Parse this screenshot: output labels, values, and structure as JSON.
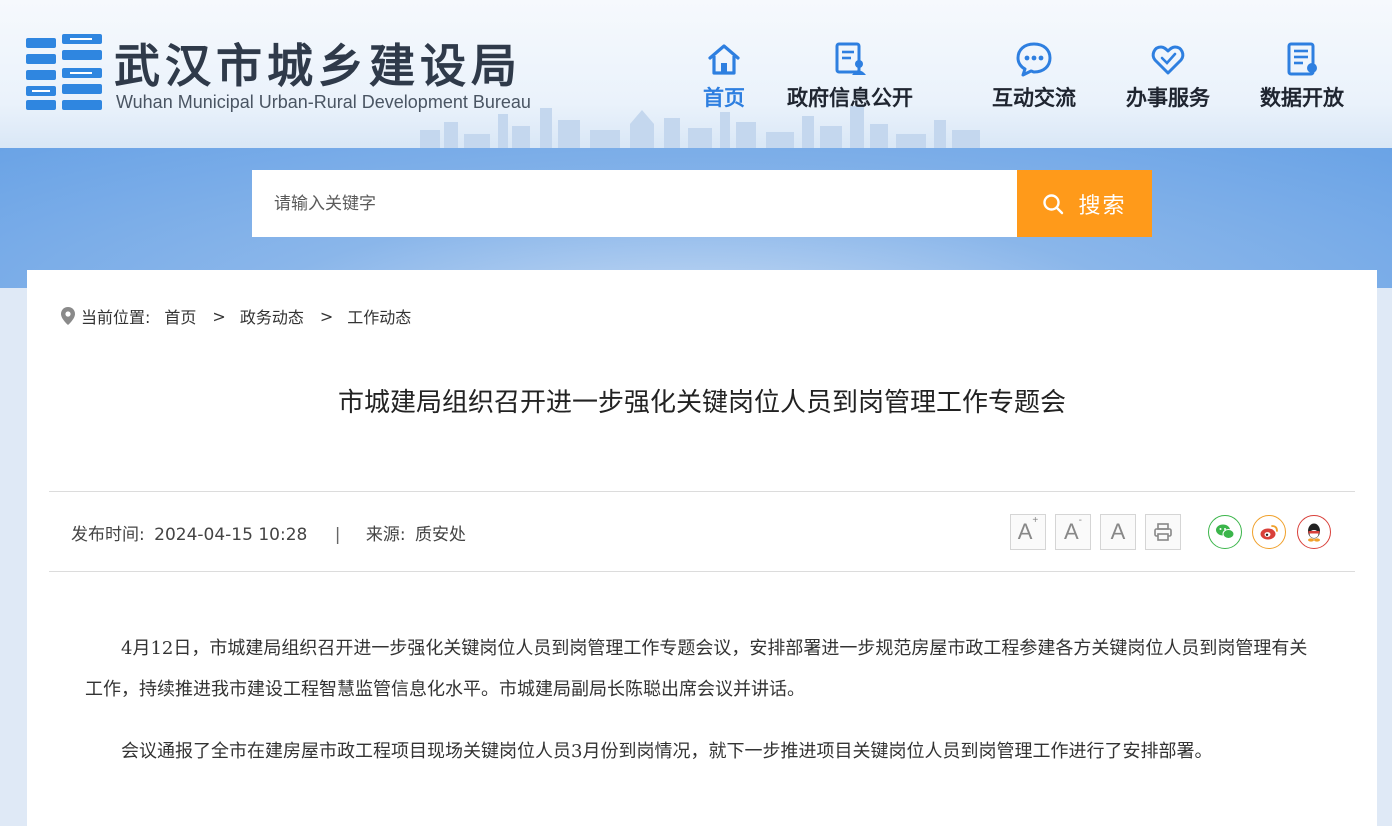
{
  "header": {
    "logo_cn": "武汉市城乡建设局",
    "logo_en": "Wuhan Municipal Urban-Rural Development Bureau",
    "nav": [
      {
        "label": "首页",
        "icon": "home-icon",
        "active": true
      },
      {
        "label": "政府信息公开",
        "icon": "document-user-icon",
        "active": false
      },
      {
        "label": "互动交流",
        "icon": "chat-bubble-icon",
        "active": false
      },
      {
        "label": "办事服务",
        "icon": "heart-hand-icon",
        "active": false
      },
      {
        "label": "数据开放",
        "icon": "data-doc-icon",
        "active": false
      }
    ]
  },
  "search": {
    "placeholder": "请输入关键字",
    "button_label": "搜索"
  },
  "breadcrumb": {
    "prefix": "当前位置:",
    "items": [
      "首页",
      "政务动态",
      "工作动态"
    ]
  },
  "article": {
    "title": "市城建局组织召开进一步强化关键岗位人员到岗管理工作专题会",
    "publish_label": "发布时间:",
    "publish_time": "2024-04-15 10:28",
    "separator": "|",
    "source_label": "来源:",
    "source": "质安处",
    "paragraphs": [
      "4月12日，市城建局组织召开进一步强化关键岗位人员到岗管理工作专题会议，安排部署进一步规范房屋市政工程参建各方关键岗位人员到岗管理有关工作，持续推进我市建设工程智慧监管信息化水平。市城建局副局长陈聪出席会议并讲话。",
      "会议通报了全市在建房屋市政工程项目现场关键岗位人员3月份到岗情况，就下一步推进项目关键岗位人员到岗管理工作进行了安排部署。"
    ]
  },
  "tools": {
    "font_larger": "A",
    "font_smaller": "A",
    "font_default": "A"
  },
  "colors": {
    "nav_active": "#2e7fe0",
    "search_button": "#ff9a1a",
    "wechat": "#3bb54a",
    "weibo": "#f0a02a",
    "qq": "#d9403a"
  }
}
